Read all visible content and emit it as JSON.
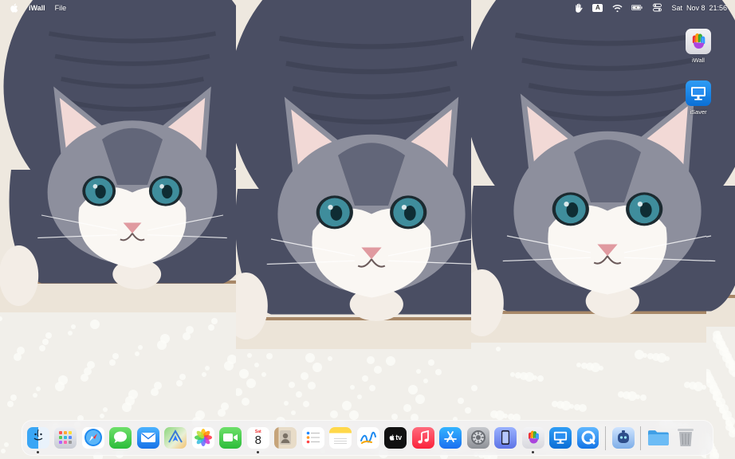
{
  "menubar": {
    "app_name": "iWall",
    "menus": [
      "File"
    ],
    "day": "Sat",
    "date": "Nov 8",
    "time": "21:56",
    "input_source": "A"
  },
  "desktop_icons": [
    {
      "label": "iWall",
      "icon": "hand-print-icon"
    },
    {
      "label": "iSaver",
      "icon": "monitor-icon"
    }
  ],
  "dock": {
    "calendar": {
      "month": "Sat",
      "day": "8"
    },
    "items": [
      {
        "name": "Finder",
        "icon": "finder-icon",
        "running": true
      },
      {
        "name": "Launchpad",
        "icon": "launchpad-icon",
        "running": false
      },
      {
        "name": "Safari",
        "icon": "safari-icon",
        "running": false
      },
      {
        "name": "Messages",
        "icon": "messages-icon",
        "running": false
      },
      {
        "name": "Mail",
        "icon": "mail-icon",
        "running": false
      },
      {
        "name": "Maps",
        "icon": "maps-icon",
        "running": false
      },
      {
        "name": "Photos",
        "icon": "photos-icon",
        "running": false
      },
      {
        "name": "FaceTime",
        "icon": "facetime-icon",
        "running": false
      },
      {
        "name": "Calendar",
        "icon": "calendar-icon",
        "running": true
      },
      {
        "name": "Contacts",
        "icon": "contacts-icon",
        "running": false
      },
      {
        "name": "Reminders",
        "icon": "reminders-icon",
        "running": false
      },
      {
        "name": "Notes",
        "icon": "notes-icon",
        "running": false
      },
      {
        "name": "Freeform",
        "icon": "freeform-icon",
        "running": false
      },
      {
        "name": "TV",
        "icon": "apple-tv-icon",
        "running": false
      },
      {
        "name": "Music",
        "icon": "music-icon",
        "running": false
      },
      {
        "name": "App Store",
        "icon": "app-store-icon",
        "running": false
      },
      {
        "name": "System Settings",
        "icon": "system-settings-icon",
        "running": false
      },
      {
        "name": "iPhone Mirroring",
        "icon": "iphone-mirroring-icon",
        "running": false
      },
      {
        "name": "iWall",
        "icon": "hand-print-icon",
        "running": true
      },
      {
        "name": "iSaver",
        "icon": "monitor-icon",
        "running": false
      },
      {
        "name": "QuickTime",
        "icon": "quicktime-icon",
        "running": false
      },
      {
        "name": "Assistant",
        "icon": "assistant-icon",
        "running": false
      },
      {
        "name": "Downloads",
        "icon": "folder-icon",
        "running": false
      },
      {
        "name": "Trash",
        "icon": "trash-icon",
        "running": false
      }
    ],
    "tv_label": "tv"
  },
  "colors": {
    "dock_bg": "#f0f0f4",
    "cat_fur_dark": "#4a4e63",
    "cat_fur_light": "#8d8f9d",
    "cat_eye": "#3f8d9c",
    "cat_nose": "#e09aa0",
    "carpet": "#f1efea",
    "mat": "#a88868",
    "floor_wall": "#eee8df"
  }
}
